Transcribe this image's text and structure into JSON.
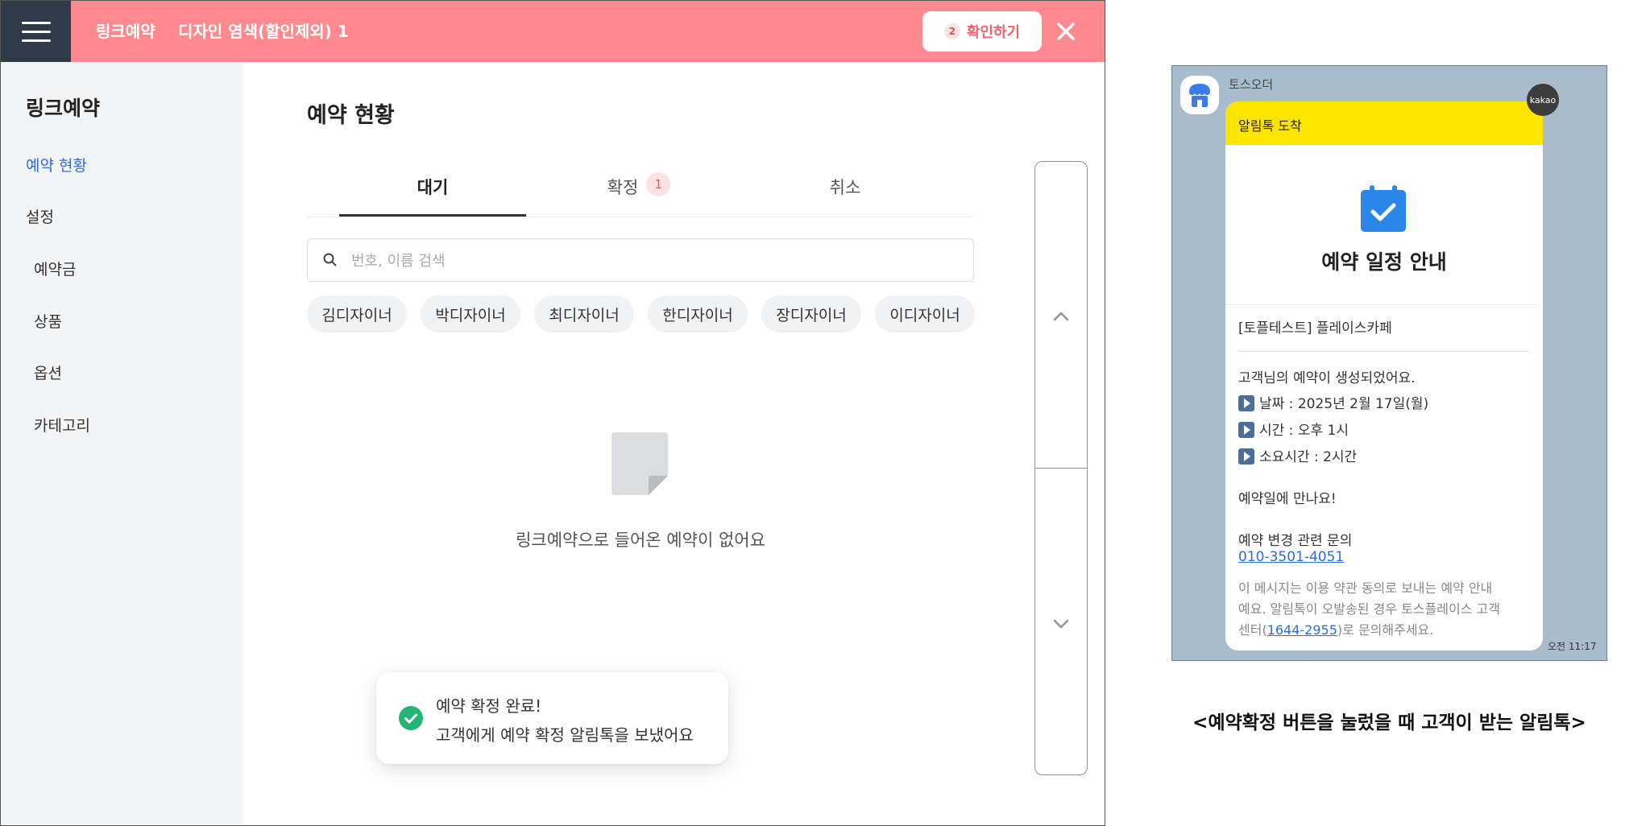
{
  "header": {
    "app_name": "링크예약",
    "subtitle": "디자인 염색(할인제외) 1",
    "confirm_count": "2",
    "confirm_label": "확인하기"
  },
  "sidebar": {
    "title": "링크예약",
    "items": [
      {
        "label": "예약 현황",
        "active": true
      },
      {
        "label": "설정",
        "active": false
      },
      {
        "label": "예약금",
        "active": false
      },
      {
        "label": "상품",
        "active": false
      },
      {
        "label": "옵션",
        "active": false
      },
      {
        "label": "카테고리",
        "active": false
      }
    ]
  },
  "main": {
    "title": "예약 현황",
    "tabs": [
      {
        "label": "대기",
        "active": true
      },
      {
        "label": "확정",
        "badge": "1"
      },
      {
        "label": "취소"
      }
    ],
    "search_placeholder": "번호, 이름 검색",
    "chips": [
      "김디자이너",
      "박디자이너",
      "최디자이너",
      "한디자이너",
      "장디자이너",
      "이디자이너"
    ],
    "empty_message": "링크예약으로 들어온 예약이 없어요"
  },
  "toast": {
    "title": "예약 확정 완료!",
    "message": "고객에게 예약 확정 알림톡을 보냈어요"
  },
  "kakao_message": {
    "sender": "토스오더",
    "kakao_badge": "kakao",
    "header": "알림톡 도착",
    "card_title": "예약 일정 안내",
    "store": "[토플테스트] 플레이스카페",
    "line1": "고객님의 예약이 생성되었어요.",
    "date_line": "날짜 : 2025년 2월 17일(월)",
    "time_line": "시간 : 오후 1시",
    "duration_line": "소요시간 : 2시간",
    "greeting": "예약일에 만나요!",
    "inquiry": "예약 변경 관련 문의",
    "phone": "010-3501-4051",
    "notice1": "이 메시지는 이용 약관 동의로 보내는 예약 안내",
    "notice2": "예요. 알림톡이 오발송된 경우 토스플레이스 고객",
    "notice3_prefix": "센터(",
    "notice3_phone": "1644-2955",
    "notice3_suffix": ")로 문의해주세요.",
    "timestamp": "오전 11:17"
  },
  "caption": "<예약확정 버튼을 눌렀을 때 고객이 받는 알림톡>",
  "colors": {
    "topbar": "#fe8a8f",
    "menu_button": "#2f3b48",
    "accent_blue": "#2a6de0",
    "kakao_yellow": "#fee500",
    "chat_background": "#a9bccd",
    "success_green": "#22b573"
  },
  "icons": {
    "menu": "hamburger-menu-icon",
    "close": "close-icon",
    "search": "search-icon",
    "empty": "empty-document-icon",
    "scroll_up": "chevron-up-icon",
    "scroll_down": "chevron-down-icon",
    "toast": "check-circle-icon",
    "calendar": "calendar-check-icon",
    "play": "play-icon"
  }
}
